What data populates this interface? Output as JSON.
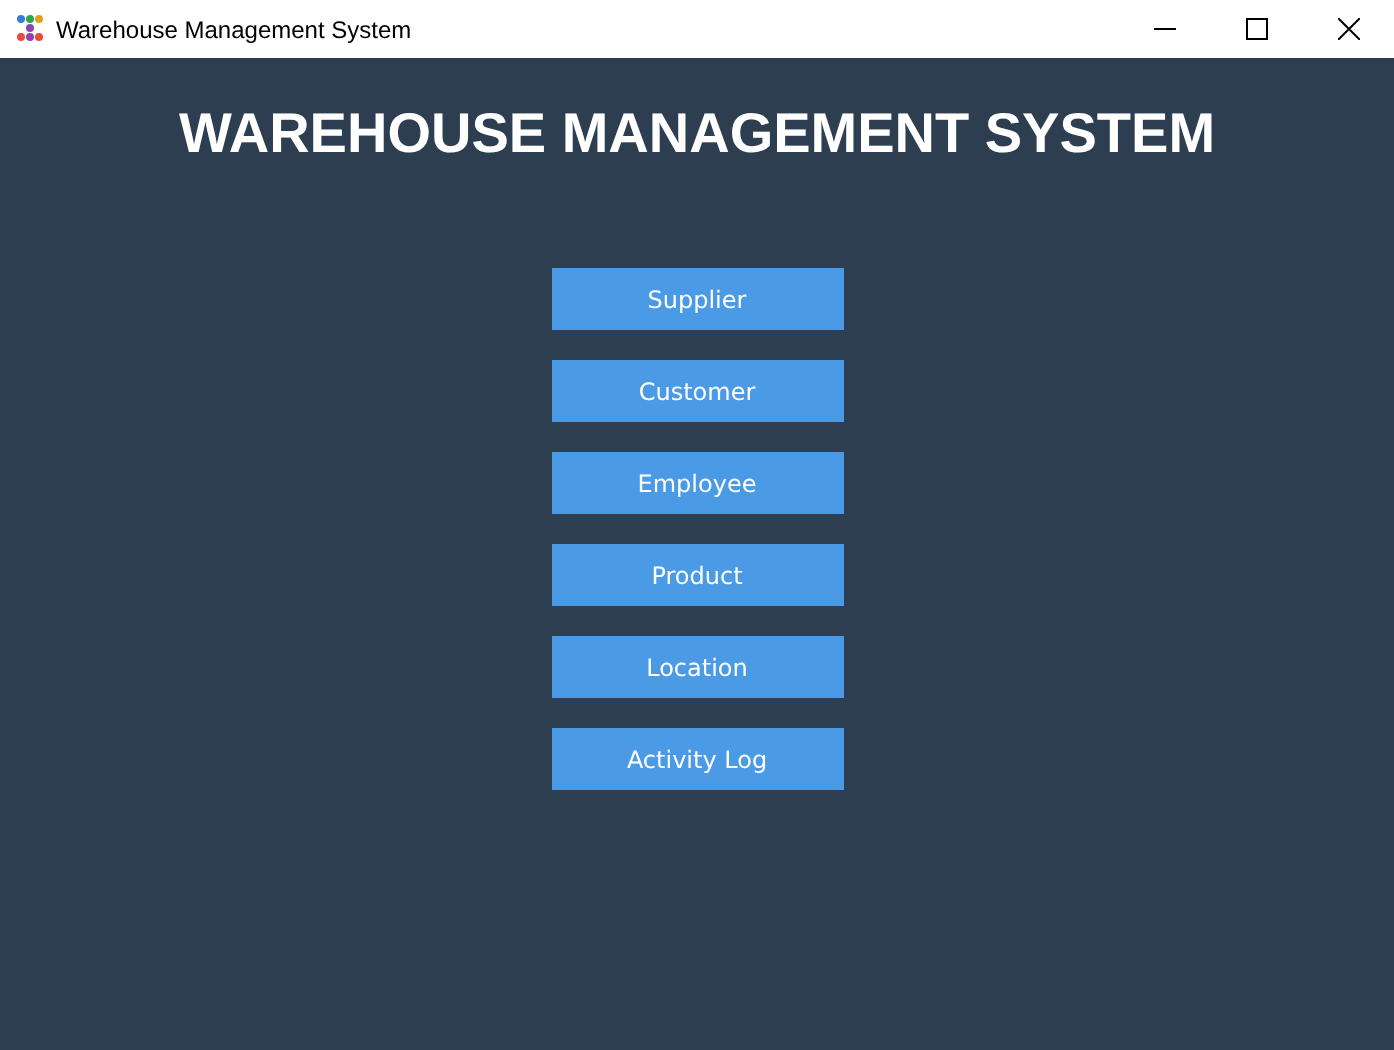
{
  "window": {
    "title": "Warehouse Management System"
  },
  "heading": "WAREHOUSE MANAGEMENT SYSTEM",
  "buttons": [
    "Supplier",
    "Customer",
    "Employee",
    "Product",
    "Location",
    "Activity Log"
  ]
}
